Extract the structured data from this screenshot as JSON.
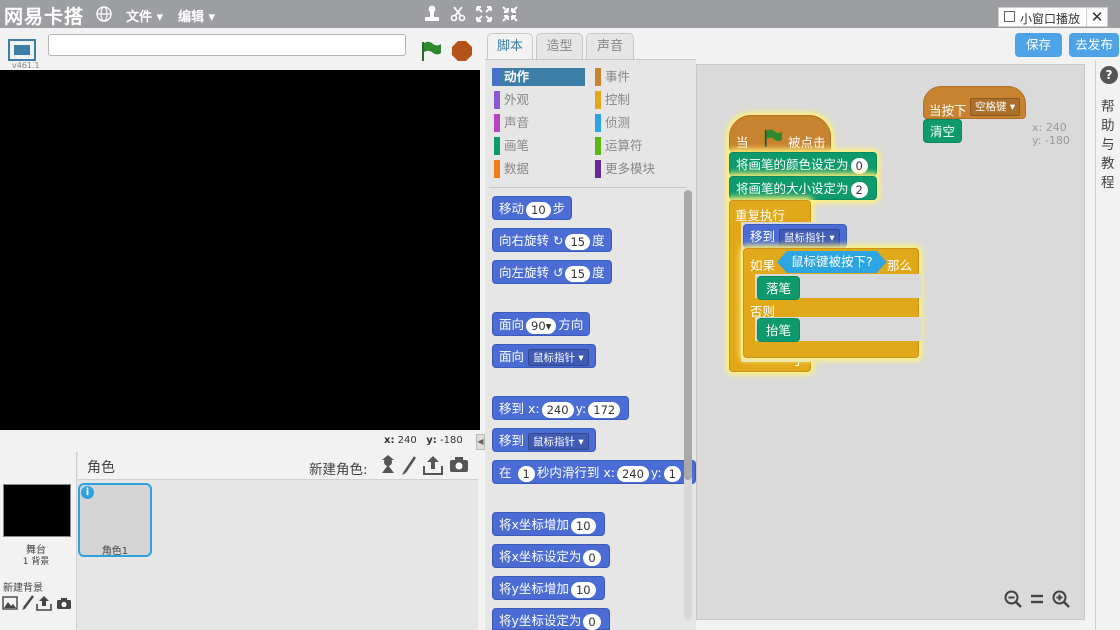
{
  "topbar": {
    "brand": "网易卡搭",
    "menus": [
      {
        "label": "文件"
      },
      {
        "label": "编辑"
      }
    ],
    "mini_window": "小窗口播放"
  },
  "stage": {
    "version": "v461.1",
    "project_title": "",
    "coord_x_label": "x:",
    "coord_x": "240",
    "coord_y_label": "y:",
    "coord_y": "-180"
  },
  "sprites": {
    "header": "角色",
    "new_sprite_label": "新建角色:",
    "stage_label": "舞台",
    "stage_backdrops": "1 背景",
    "new_backdrop_label": "新建背景",
    "sprite1_name": "角色1"
  },
  "tabs": [
    {
      "label": "脚本"
    },
    {
      "label": "造型"
    },
    {
      "label": "声音"
    }
  ],
  "actions": {
    "save": "保存",
    "publish": "去发布"
  },
  "categories": [
    {
      "label": "动作",
      "color": "#4a6cd4"
    },
    {
      "label": "事件",
      "color": "#c88330"
    },
    {
      "label": "外观",
      "color": "#8a55d7"
    },
    {
      "label": "控制",
      "color": "#e1a91a"
    },
    {
      "label": "声音",
      "color": "#bb42c3"
    },
    {
      "label": "侦测",
      "color": "#2ca5e2"
    },
    {
      "label": "画笔",
      "color": "#0e9a6c"
    },
    {
      "label": "运算符",
      "color": "#5cb712"
    },
    {
      "label": "数据",
      "color": "#ee7d16"
    },
    {
      "label": "更多模块",
      "color": "#632d99"
    }
  ],
  "palette": {
    "move": {
      "a": "移动",
      "n": "10",
      "b": "步"
    },
    "turn_right": {
      "a": "向右旋转",
      "n": "15",
      "b": "度"
    },
    "turn_left": {
      "a": "向左旋转",
      "n": "15",
      "b": "度"
    },
    "point_dir": {
      "a": "面向",
      "n": "90▾",
      "b": "方向"
    },
    "point_towards": {
      "a": "面向",
      "d": "鼠标指针"
    },
    "goto_xy": {
      "a": "移到",
      "x": "x:",
      "xv": "240",
      "y": "y:",
      "yv": "172"
    },
    "goto": {
      "a": "移到",
      "d": "鼠标指针"
    },
    "glide": {
      "a": "在",
      "n": "1",
      "b": "秒内滑行到",
      "x": "x:",
      "xv": "240",
      "y": "y:",
      "yv": "1"
    },
    "change_x": {
      "a": "将x坐标增加",
      "n": "10"
    },
    "set_x": {
      "a": "将x坐标设定为",
      "n": "0"
    },
    "change_y": {
      "a": "将y坐标增加",
      "n": "10"
    },
    "set_y": {
      "a": "将y坐标设定为",
      "n": "0"
    }
  },
  "script": {
    "hat_when": "当",
    "hat_clicked": "被点击",
    "set_color": "将画笔的颜色设定为",
    "set_color_val": "0",
    "set_size": "将画笔的大小设定为",
    "set_size_val": "2",
    "forever": "重复执行",
    "goto": "移到",
    "goto_target": "鼠标指针",
    "if": "如果",
    "mouse_down": "鼠标键被按下?",
    "then": "那么",
    "pen_down": "落笔",
    "else": "否则",
    "pen_up": "抬笔",
    "key_hat": "当按下",
    "key": "空格键",
    "clear": "清空",
    "sprite_x": "x: 240",
    "sprite_y": "y: -180"
  },
  "help": {
    "text": "帮助与教程"
  }
}
